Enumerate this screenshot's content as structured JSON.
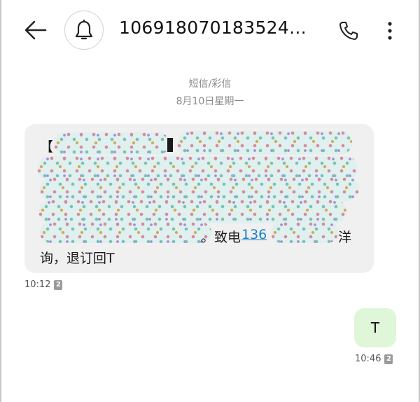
{
  "header": {
    "back_icon": "arrow-left-icon",
    "bell_icon": "bell-icon",
    "title": "106918070183524...",
    "call_icon": "phone-icon",
    "more_icon": "more-vertical-icon"
  },
  "thread": {
    "message_type": "短信/彩信",
    "date": "8月10日星期一"
  },
  "incoming": {
    "line1_prefix": "【",
    "line6_text": "。致电",
    "phone_link": "136",
    "line6_suffix": "洋",
    "line7_text": "询，退订回T",
    "time": "10:12",
    "sim": "2"
  },
  "outgoing": {
    "text": "T",
    "time": "10:46",
    "sim": "2"
  },
  "colors": {
    "incoming_bubble": "#f0f0f0",
    "outgoing_bubble": "#dff6d9",
    "link": "#1a82c4"
  }
}
